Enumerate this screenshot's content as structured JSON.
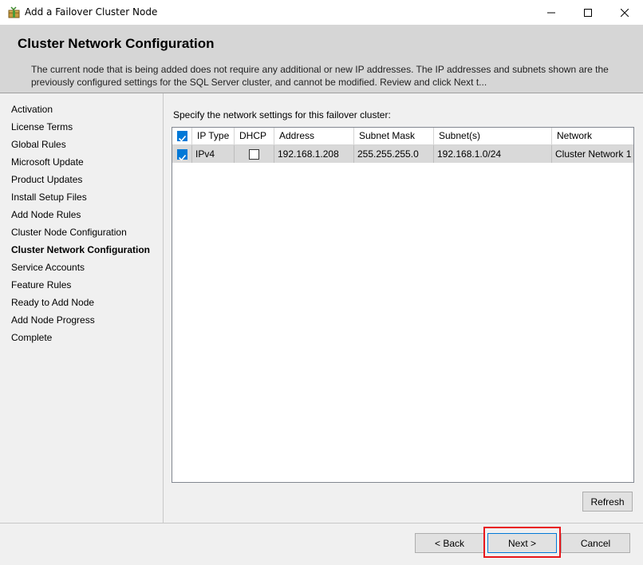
{
  "window": {
    "title": "Add a Failover Cluster Node",
    "icon": "setup-box-icon",
    "controls": [
      "minimize-icon",
      "maximize-icon",
      "close-icon"
    ]
  },
  "header": {
    "title": "Cluster Network Configuration",
    "description": "The current node that is being added does not require any additional or new IP addresses.  The IP addresses and subnets shown are the previously configured settings for the SQL Server cluster, and cannot be modified. Review and click Next t..."
  },
  "nav": {
    "items": [
      {
        "label": "Activation",
        "active": false
      },
      {
        "label": "License Terms",
        "active": false
      },
      {
        "label": "Global Rules",
        "active": false
      },
      {
        "label": "Microsoft Update",
        "active": false
      },
      {
        "label": "Product Updates",
        "active": false
      },
      {
        "label": "Install Setup Files",
        "active": false
      },
      {
        "label": "Add Node Rules",
        "active": false
      },
      {
        "label": "Cluster Node Configuration",
        "active": false
      },
      {
        "label": "Cluster Network Configuration",
        "active": true
      },
      {
        "label": "Service Accounts",
        "active": false
      },
      {
        "label": "Feature Rules",
        "active": false
      },
      {
        "label": "Ready to Add Node",
        "active": false
      },
      {
        "label": "Add Node Progress",
        "active": false
      },
      {
        "label": "Complete",
        "active": false
      }
    ]
  },
  "main": {
    "instruction": "Specify the network settings for this failover cluster:",
    "grid": {
      "header_checkbox_checked": true,
      "columns": [
        "IP Type",
        "DHCP",
        "Address",
        "Subnet Mask",
        "Subnet(s)",
        "Network"
      ],
      "rows": [
        {
          "checked": true,
          "ip_type": "IPv4",
          "dhcp": false,
          "address": "192.168.1.208",
          "subnet_mask": "255.255.255.0",
          "subnets": "192.168.1.0/24",
          "network": "Cluster Network 1"
        }
      ]
    },
    "refresh_label": "Refresh"
  },
  "footer": {
    "back_label": "< Back",
    "next_label": "Next >",
    "cancel_label": "Cancel"
  },
  "colors": {
    "accent": "#0078d7",
    "highlight": "#e8161b",
    "header_bg": "#d6d6d6",
    "row_bg": "#d9d9d9"
  }
}
